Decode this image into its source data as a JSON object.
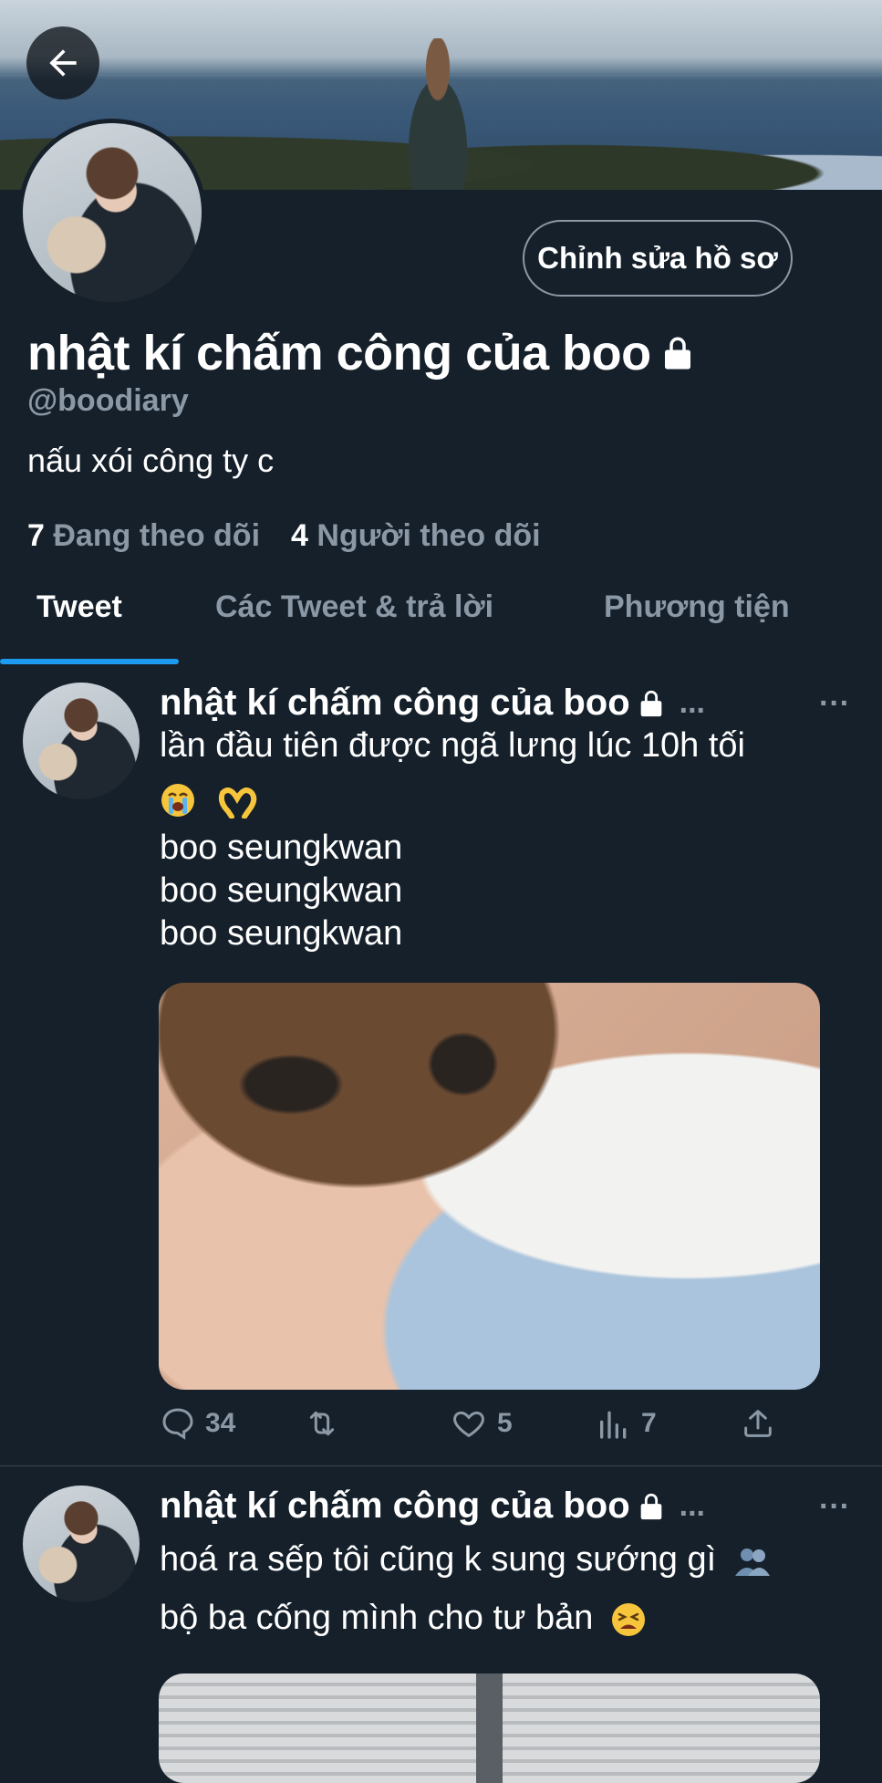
{
  "profile": {
    "display_name": "nhật kí chấm công của boo",
    "handle": "@boodiary",
    "bio": "nấu xói công ty c",
    "edit_button": "Chỉnh sửa hồ sơ",
    "following_count": "7",
    "following_label": "Đang theo dõi",
    "followers_count": "4",
    "followers_label": "Người theo dõi"
  },
  "tabs": [
    {
      "label": "Tweet",
      "active": true
    },
    {
      "label": "Các Tweet & trả lời",
      "active": false
    },
    {
      "label": "Phương tiện",
      "active": false
    }
  ],
  "tweets": [
    {
      "author": "nhật kí chấm công của boo",
      "truncation": "...",
      "more": "···",
      "lines": [
        "lần đầu tiên được ngã lưng lúc 10h tối",
        "boo seungkwan",
        "boo seungkwan",
        "boo seungkwan"
      ],
      "emoji_line": [
        "loudly-crying-face",
        "heart-hands"
      ],
      "actions": {
        "replies": "34",
        "retweets": "",
        "likes": "5",
        "views": "7"
      }
    },
    {
      "author": "nhật kí chấm công của boo",
      "truncation": "...",
      "more": "···",
      "lines": [
        "hoá ra sếp tôi cũng k sung sướng gì",
        "bộ ba cống mình cho tư bản"
      ],
      "emoji_line": [
        "bust-in-silhouette",
        "tired-face"
      ]
    }
  ],
  "colors": {
    "background": "#15202b",
    "secondary_text": "#8b98a5",
    "accent": "#1d9bf0",
    "divider": "#38444d"
  }
}
